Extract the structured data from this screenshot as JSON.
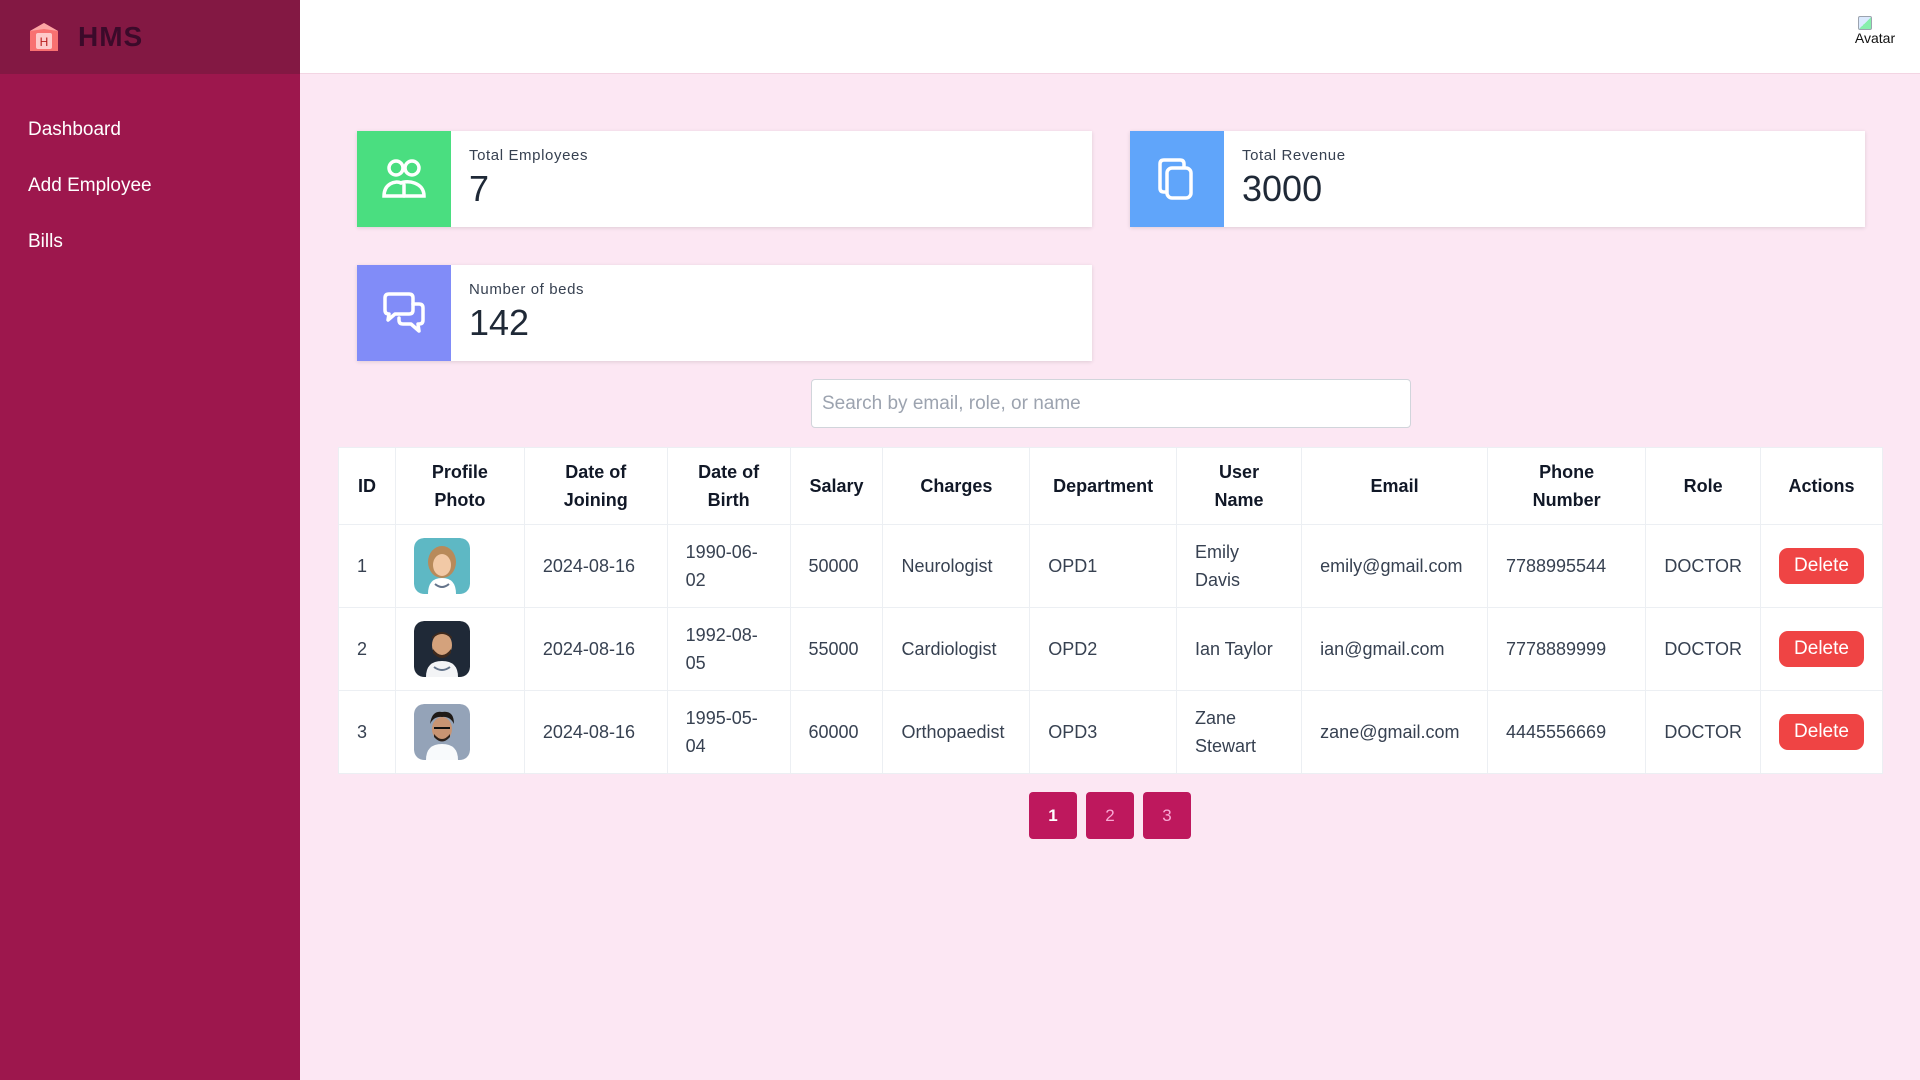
{
  "app": {
    "name": "HMS",
    "logo_letter": "H"
  },
  "sidebar": {
    "items": [
      {
        "label": "Dashboard"
      },
      {
        "label": "Add Employee"
      },
      {
        "label": "Bills"
      }
    ]
  },
  "header": {
    "avatar_alt": "Avatar"
  },
  "stats": {
    "employees": {
      "label": "Total Employees",
      "value": "7",
      "color": "#4ade80",
      "icon": "users-icon"
    },
    "revenue": {
      "label": "Total Revenue",
      "value": "3000",
      "color": "#60a5fa",
      "icon": "copy-icon"
    },
    "beds": {
      "label": "Number of beds",
      "value": "142",
      "color": "#818cf8",
      "icon": "chat-icon"
    }
  },
  "search": {
    "placeholder": "Search by email, role, or name",
    "value": ""
  },
  "table": {
    "headers": [
      [
        "ID"
      ],
      [
        "Profile",
        "Photo"
      ],
      [
        "Date of",
        "Joining"
      ],
      [
        "Date of",
        "Birth"
      ],
      [
        "Salary"
      ],
      [
        "Charges"
      ],
      [
        "Department"
      ],
      [
        "User",
        "Name"
      ],
      [
        "Email"
      ],
      [
        "Phone",
        "Number"
      ],
      [
        "Role"
      ],
      [
        "Actions"
      ]
    ],
    "rows": [
      {
        "id": "1",
        "joining": "2024-08-16",
        "dob": [
          "1990-06-",
          "02"
        ],
        "salary": "50000",
        "charges": "Neurologist",
        "department": "OPD1",
        "name": [
          "Emily",
          "Davis"
        ],
        "email": "emily@gmail.com",
        "phone": "7788995544",
        "role": "DOCTOR",
        "action": "Delete"
      },
      {
        "id": "2",
        "joining": "2024-08-16",
        "dob": [
          "1992-08-",
          "05"
        ],
        "salary": "55000",
        "charges": "Cardiologist",
        "department": "OPD2",
        "name": [
          "Ian Taylor"
        ],
        "email": "ian@gmail.com",
        "phone": "7778889999",
        "role": "DOCTOR",
        "action": "Delete"
      },
      {
        "id": "3",
        "joining": "2024-08-16",
        "dob": [
          "1995-05-",
          "04"
        ],
        "salary": "60000",
        "charges": "Orthopaedist",
        "department": "OPD3",
        "name": [
          "Zane",
          "Stewart"
        ],
        "email": "zane@gmail.com",
        "phone": "4445556669",
        "role": "DOCTOR",
        "action": "Delete"
      }
    ]
  },
  "pagination": {
    "pages": [
      "1",
      "2",
      "3"
    ],
    "current": "1"
  },
  "colors": {
    "sidebar": "#9d174d",
    "brand_bar": "#831843",
    "background": "#fce7f3",
    "danger": "#ef4444",
    "pager": "#be185d"
  }
}
